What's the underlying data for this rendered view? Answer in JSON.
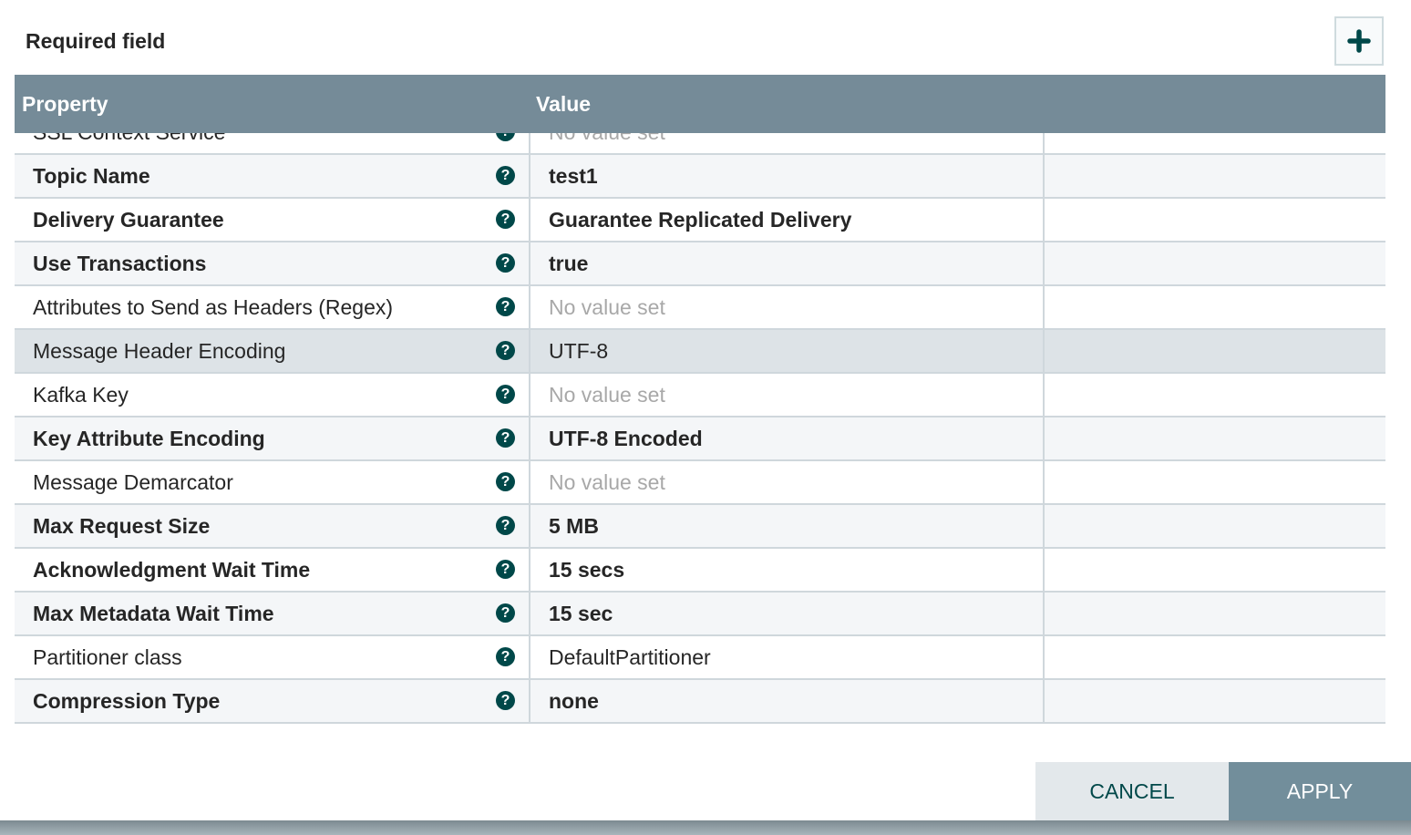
{
  "header": {
    "required_label": "Required field",
    "add_icon": "plus-icon"
  },
  "table": {
    "columns": [
      "Property",
      "Value"
    ],
    "rows": [
      {
        "property": "SSL Context Service",
        "value": "No value set",
        "required": false,
        "empty": true
      },
      {
        "property": "Topic Name",
        "value": "test1",
        "required": true,
        "empty": false
      },
      {
        "property": "Delivery Guarantee",
        "value": "Guarantee Replicated Delivery",
        "required": true,
        "empty": false
      },
      {
        "property": "Use Transactions",
        "value": "true",
        "required": true,
        "empty": false
      },
      {
        "property": "Attributes to Send as Headers (Regex)",
        "value": "No value set",
        "required": false,
        "empty": true
      },
      {
        "property": "Message Header Encoding",
        "value": "UTF-8",
        "required": false,
        "empty": false,
        "selected": true
      },
      {
        "property": "Kafka Key",
        "value": "No value set",
        "required": false,
        "empty": true
      },
      {
        "property": "Key Attribute Encoding",
        "value": "UTF-8 Encoded",
        "required": true,
        "empty": false
      },
      {
        "property": "Message Demarcator",
        "value": "No value set",
        "required": false,
        "empty": true
      },
      {
        "property": "Max Request Size",
        "value": "5 MB",
        "required": true,
        "empty": false
      },
      {
        "property": "Acknowledgment Wait Time",
        "value": "15 secs",
        "required": true,
        "empty": false
      },
      {
        "property": "Max Metadata Wait Time",
        "value": "15 sec",
        "required": true,
        "empty": false
      },
      {
        "property": "Partitioner class",
        "value": "DefaultPartitioner",
        "required": false,
        "empty": false
      },
      {
        "property": "Compression Type",
        "value": "none",
        "required": true,
        "empty": false
      }
    ]
  },
  "footer": {
    "cancel_label": "CANCEL",
    "apply_label": "APPLY"
  },
  "colors": {
    "header_bg": "#758b98",
    "accent": "#004849",
    "selected_row": "#dde3e7"
  }
}
